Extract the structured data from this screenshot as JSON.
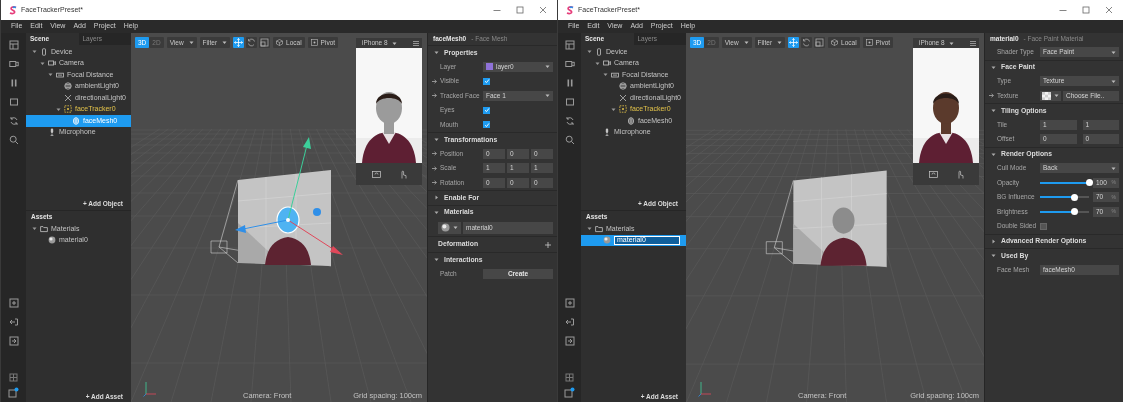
{
  "windows": [
    {
      "title": "FaceTrackerPreset*",
      "menu": [
        "File",
        "Edit",
        "View",
        "Add",
        "Project",
        "Help"
      ],
      "scene_tabs": [
        {
          "label": "Scene",
          "selected": true
        },
        {
          "label": "Layers",
          "selected": false
        }
      ],
      "scene_tree": [
        {
          "label": "Device",
          "kind": "device",
          "expanded": true,
          "selected": false,
          "children": [
            {
              "label": "Camera",
              "kind": "camera",
              "expanded": true,
              "selected": false,
              "children": [
                {
                  "label": "Focal Distance",
                  "kind": "focal",
                  "expanded": true,
                  "selected": false,
                  "children": [
                    {
                      "label": "ambientLight0",
                      "kind": "ambient",
                      "selected": false
                    },
                    {
                      "label": "directionalLight0",
                      "kind": "directional",
                      "selected": false
                    },
                    {
                      "label": "faceTracker0",
                      "kind": "tracker",
                      "expanded": true,
                      "selected": false,
                      "children": [
                        {
                          "label": "faceMesh0",
                          "kind": "mesh",
                          "selected": true
                        }
                      ]
                    }
                  ]
                }
              ]
            },
            {
              "label": "Microphone",
              "kind": "mic",
              "selected": false
            }
          ]
        }
      ],
      "add_object": "+ Add Object",
      "assets_title": "Assets",
      "assets_tree": [
        {
          "label": "Materials",
          "kind": "folder",
          "expanded": true,
          "selected": false,
          "children": [
            {
              "label": "material0",
              "kind": "material",
              "selected": false,
              "editing": false
            }
          ]
        }
      ],
      "add_asset": "+ Add Asset",
      "viewport": {
        "modes": [
          {
            "label": "3D",
            "selected": true
          },
          {
            "label": "2D",
            "selected": false
          }
        ],
        "menus": [
          "View",
          "Filter"
        ],
        "tools": [
          {
            "kind": "move",
            "selected": true
          },
          {
            "kind": "rotate",
            "selected": false
          },
          {
            "kind": "scale",
            "selected": false
          }
        ],
        "space_buttons": [
          {
            "kind": "local",
            "label": "Local"
          },
          {
            "kind": "pivot",
            "label": "Pivot"
          }
        ],
        "gizmo": true,
        "mesh_highlight": true,
        "device": "iPhone 8",
        "camera": "Camera: Front",
        "grid": "Grid spacing: 100cm"
      },
      "inspector": {
        "name": "faceMesh0",
        "type": "- Face Mesh",
        "rows": [
          {
            "kind": "section",
            "label": "Properties",
            "expanded": true
          },
          {
            "kind": "select",
            "label": "Layer",
            "value": "layer0",
            "color": "#8f72d8",
            "patchable": false
          },
          {
            "kind": "checkbox",
            "label": "Visible",
            "checked": true,
            "patchable": true
          },
          {
            "kind": "select",
            "label": "Tracked Face",
            "value": "Face 1",
            "patchable": true
          },
          {
            "kind": "checkbox",
            "label": "Eyes",
            "checked": true,
            "patchable": false
          },
          {
            "kind": "checkbox",
            "label": "Mouth",
            "checked": true,
            "patchable": false
          },
          {
            "kind": "section",
            "label": "Transformations",
            "expanded": true
          },
          {
            "kind": "vector",
            "label": "Position",
            "values": [
              "0",
              "0",
              "0"
            ],
            "patchable": true
          },
          {
            "kind": "vector",
            "label": "Scale",
            "values": [
              "1",
              "1",
              "1"
            ],
            "patchable": true
          },
          {
            "kind": "vector",
            "label": "Rotation",
            "values": [
              "0",
              "0",
              "0"
            ],
            "patchable": true
          },
          {
            "kind": "section",
            "label": "Enable For",
            "expanded": false
          },
          {
            "kind": "section",
            "label": "Materials",
            "expanded": true
          },
          {
            "kind": "material",
            "value": "material0"
          },
          {
            "kind": "add",
            "label": "Deformation"
          },
          {
            "kind": "section",
            "label": "Interactions",
            "expanded": true
          },
          {
            "kind": "button",
            "label": "Patch",
            "value": "Create",
            "patchable": false
          }
        ]
      }
    },
    {
      "title": "FaceTrackerPreset*",
      "menu": [
        "File",
        "Edit",
        "View",
        "Add",
        "Project",
        "Help"
      ],
      "scene_tabs": [
        {
          "label": "Scene",
          "selected": true
        },
        {
          "label": "Layers",
          "selected": false
        }
      ],
      "scene_tree": [
        {
          "label": "Device",
          "kind": "device",
          "expanded": true,
          "selected": false,
          "children": [
            {
              "label": "Camera",
              "kind": "camera",
              "expanded": true,
              "selected": false,
              "children": [
                {
                  "label": "Focal Distance",
                  "kind": "focal",
                  "expanded": true,
                  "selected": false,
                  "children": [
                    {
                      "label": "ambientLight0",
                      "kind": "ambient",
                      "selected": false
                    },
                    {
                      "label": "directionalLight0",
                      "kind": "directional",
                      "selected": false
                    },
                    {
                      "label": "faceTracker0",
                      "kind": "tracker",
                      "expanded": true,
                      "selected": false,
                      "children": [
                        {
                          "label": "faceMesh0",
                          "kind": "mesh",
                          "selected": false
                        }
                      ]
                    }
                  ]
                }
              ]
            },
            {
              "label": "Microphone",
              "kind": "mic",
              "selected": false
            }
          ]
        }
      ],
      "add_object": "+ Add Object",
      "assets_title": "Assets",
      "assets_tree": [
        {
          "label": "Materials",
          "kind": "folder",
          "expanded": true,
          "selected": false,
          "children": [
            {
              "label": "material0",
              "kind": "material",
              "selected": true,
              "editing": true
            }
          ]
        }
      ],
      "add_asset": "+ Add Asset",
      "viewport": {
        "modes": [
          {
            "label": "3D",
            "selected": true
          },
          {
            "label": "2D",
            "selected": false
          }
        ],
        "menus": [
          "View",
          "Filter"
        ],
        "tools": [
          {
            "kind": "move",
            "selected": true
          },
          {
            "kind": "rotate",
            "selected": false
          },
          {
            "kind": "scale",
            "selected": false
          }
        ],
        "space_buttons": [
          {
            "kind": "local",
            "label": "Local"
          },
          {
            "kind": "pivot",
            "label": "Pivot"
          }
        ],
        "gizmo": false,
        "mesh_highlight": false,
        "device": "iPhone 8",
        "camera": "Camera: Front",
        "grid": "Grid spacing: 100cm"
      },
      "inspector": {
        "name": "material0",
        "type": "- Face Paint Material",
        "rows": [
          {
            "kind": "select",
            "label": "Shader Type",
            "value": "Face Paint",
            "patchable": false
          },
          {
            "kind": "section",
            "label": "Face Paint",
            "expanded": true
          },
          {
            "kind": "select",
            "label": "Type",
            "value": "Texture",
            "patchable": false
          },
          {
            "kind": "texture",
            "label": "Texture",
            "value": "Choose File..",
            "patchable": true
          },
          {
            "kind": "section",
            "label": "Tiling Options",
            "expanded": true
          },
          {
            "kind": "pair",
            "label": "Tile",
            "values": [
              "1",
              "1"
            ],
            "patchable": false
          },
          {
            "kind": "pair",
            "label": "Offset",
            "values": [
              "0",
              "0"
            ],
            "patchable": false
          },
          {
            "kind": "section",
            "label": "Render Options",
            "expanded": true
          },
          {
            "kind": "select",
            "label": "Cull Mode",
            "value": "Back",
            "patchable": false
          },
          {
            "kind": "slider",
            "label": "Opacity",
            "level": 1,
            "value": "100",
            "unit": "%",
            "patchable": false
          },
          {
            "kind": "slider",
            "label": "BG Influence",
            "level": 0.7,
            "value": "70",
            "unit": "%",
            "patchable": false
          },
          {
            "kind": "slider",
            "label": "Brightness",
            "level": 0.7,
            "value": "70",
            "unit": "%",
            "patchable": false
          },
          {
            "kind": "checkbox",
            "label": "Double Sided",
            "checked": false,
            "patchable": false
          },
          {
            "kind": "section",
            "label": "Advanced Render Options",
            "expanded": false
          },
          {
            "kind": "section",
            "label": "Used By",
            "expanded": true
          },
          {
            "kind": "text",
            "label": "Face Mesh",
            "value": "faceMesh0",
            "patchable": false
          }
        ]
      }
    }
  ]
}
